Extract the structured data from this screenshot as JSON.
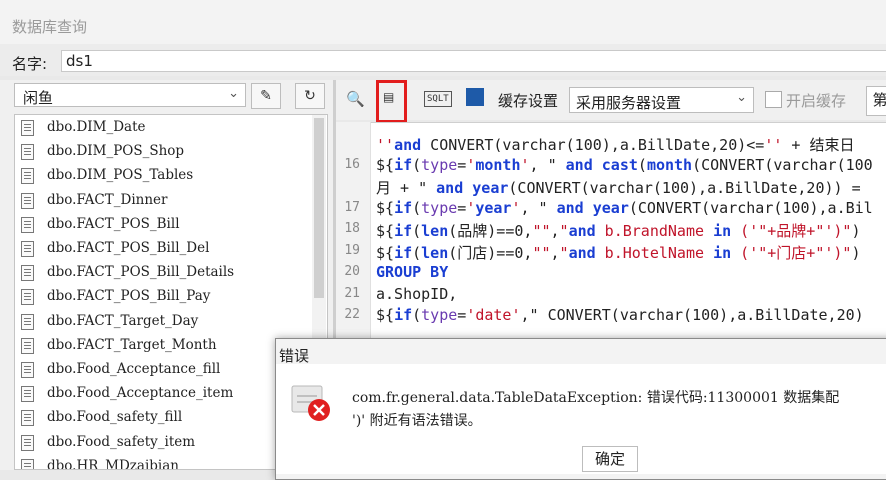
{
  "window": {
    "title": "数据库查询"
  },
  "name_field": {
    "label": "名字:",
    "value": "ds1"
  },
  "left_panel": {
    "database": "闲鱼",
    "tables": [
      "dbo.DIM_Date",
      "dbo.DIM_POS_Shop",
      "dbo.DIM_POS_Tables",
      "dbo.FACT_Dinner",
      "dbo.FACT_POS_Bill",
      "dbo.FACT_POS_Bill_Del",
      "dbo.FACT_POS_Bill_Details",
      "dbo.FACT_POS_Bill_Pay",
      "dbo.FACT_Target_Day",
      "dbo.FACT_Target_Month",
      "dbo.Food_Acceptance_fill",
      "dbo.Food_Acceptance_item",
      "dbo.Food_safety_fill",
      "dbo.Food_safety_item",
      "dbo.HR_MDzaibian"
    ]
  },
  "toolbar": {
    "cache_settings_label": "缓存设置",
    "cache_mode": "采用服务器设置",
    "enable_cache_label": "开启缓存",
    "page_label": "第",
    "icons": [
      "preview-icon",
      "sql-icon",
      "sqlt-icon",
      "cache-icon"
    ],
    "accent_color": "#e21d1d"
  },
  "editor": {
    "lines": [
      {
        "num": "",
        "text": "''and CONVERT(varchar(100),a.BillDate,20)<='' + 结束日"
      },
      {
        "num": "16",
        "text": "${if(type='month', \" and cast(month(CONVERT(varchar(100"
      },
      {
        "num": "",
        "text": "月 + \" and year(CONVERT(varchar(100),a.BillDate,20)) ="
      },
      {
        "num": "17",
        "text": "${if(type='year', \" and year(CONVERT(varchar(100),a.Bil"
      },
      {
        "num": "18",
        "text": "${if(len(品牌)==0,\"\",\"and b.BrandName in ('\"+品牌+\"')\")"
      },
      {
        "num": "19",
        "text": "${if(len(门店)==0,\"\",\"and b.HotelName in ('\"+门店+\"')\")"
      },
      {
        "num": "20",
        "text": "GROUP BY"
      },
      {
        "num": "21",
        "text": "a.ShopID,"
      },
      {
        "num": "22",
        "text": "${if(type='date',\" CONVERT(varchar(100),a.BillDate,20)"
      }
    ]
  },
  "dialog": {
    "title": "错误",
    "message_line1": "com.fr.general.data.TableDataException: 错误代码:11300001 数据集配",
    "message_line2": "')' 附近有语法错误。",
    "ok_label": "确定",
    "error_color": "#e02020"
  }
}
